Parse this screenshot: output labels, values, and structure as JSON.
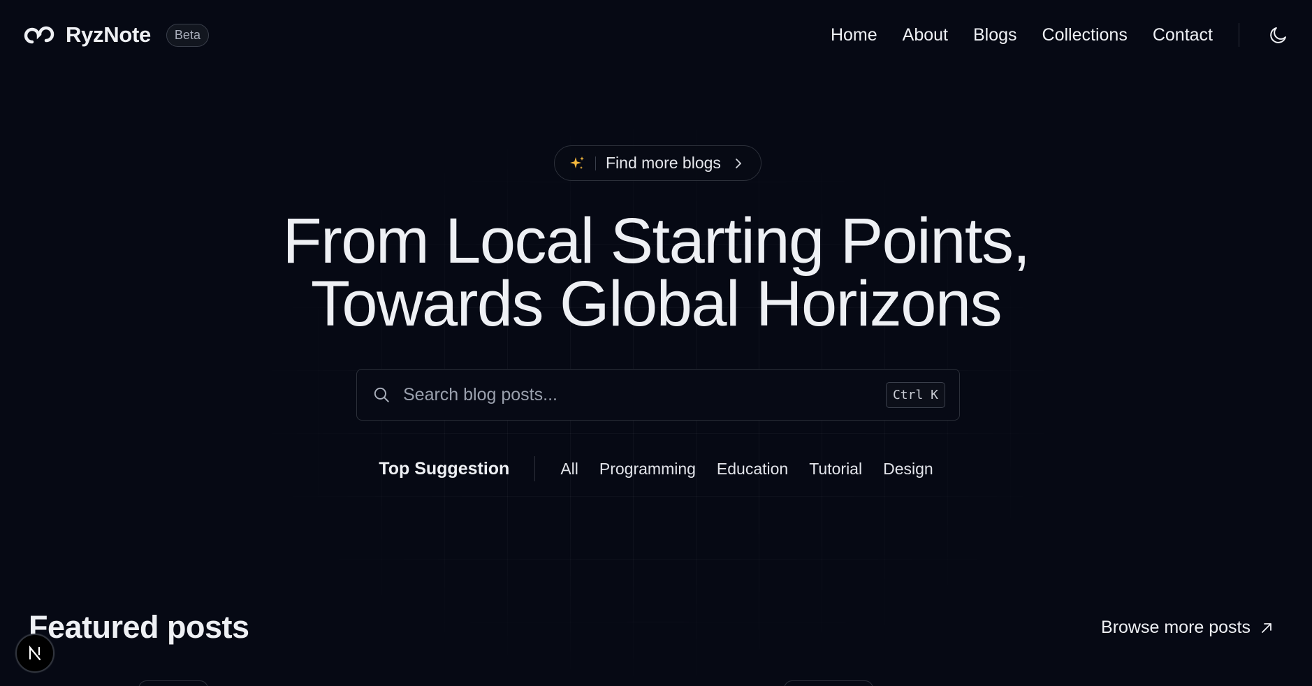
{
  "header": {
    "brand": "RyzNote",
    "badge": "Beta",
    "nav": [
      {
        "label": "Home"
      },
      {
        "label": "About"
      },
      {
        "label": "Blogs"
      },
      {
        "label": "Collections"
      },
      {
        "label": "Contact"
      }
    ],
    "theme_icon": "moon-icon"
  },
  "hero": {
    "pill_label": "Find more blogs",
    "pill_icon": "sparkles-icon",
    "title_line1": "From Local Starting Points,",
    "title_line2": "Towards Global Horizons"
  },
  "search": {
    "placeholder": "Search blog posts...",
    "shortcut": "Ctrl K"
  },
  "suggestions": {
    "title": "Top Suggestion",
    "tags": [
      "All",
      "Programming",
      "Education",
      "Tutorial",
      "Design"
    ]
  },
  "featured": {
    "title": "Featured posts",
    "browse_label": "Browse more posts"
  },
  "colors": {
    "background": "#060914",
    "text": "#eef0f4",
    "border": "#2c303a",
    "sparkle": "#f5b83d"
  }
}
